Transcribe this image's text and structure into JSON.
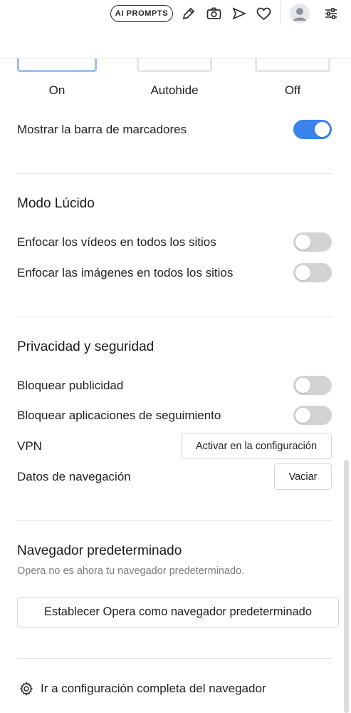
{
  "toolbar": {
    "ai_prompts_label": "AI PROMPTS",
    "icons": [
      "edit-icon",
      "camera-icon",
      "send-icon",
      "heart-icon",
      "avatar",
      "settings-sliders-icon"
    ]
  },
  "sidebar_modes": {
    "on_label": "On",
    "autohide_label": "Autohide",
    "off_label": "Off",
    "selected": "On"
  },
  "bookmarks": {
    "label": "Mostrar la barra de marcadores",
    "enabled": true
  },
  "lucid_mode": {
    "title": "Modo Lúcido",
    "videos_label": "Enfocar los vídeos en todos los sitios",
    "videos_enabled": false,
    "images_label": "Enfocar las imágenes en todos los sitios",
    "images_enabled": false
  },
  "privacy": {
    "title": "Privacidad y seguridad",
    "ads_label": "Bloquear publicidad",
    "ads_enabled": false,
    "trackers_label": "Bloquear aplicaciones de seguimiento",
    "trackers_enabled": false,
    "vpn_label": "VPN",
    "vpn_button": "Activar en la configuración",
    "browsing_data_label": "Datos de navegación",
    "clear_button": "Vaciar"
  },
  "default_browser": {
    "title": "Navegador predeterminado",
    "status": "Opera no es ahora tu navegador predeterminado.",
    "set_default_button": "Establecer Opera como navegador predeterminado"
  },
  "footer": {
    "full_settings_link": "Ir a configuración completa del navegador"
  },
  "colors": {
    "accent": "#3b82ec",
    "toggle_off": "#d3d3d6"
  }
}
